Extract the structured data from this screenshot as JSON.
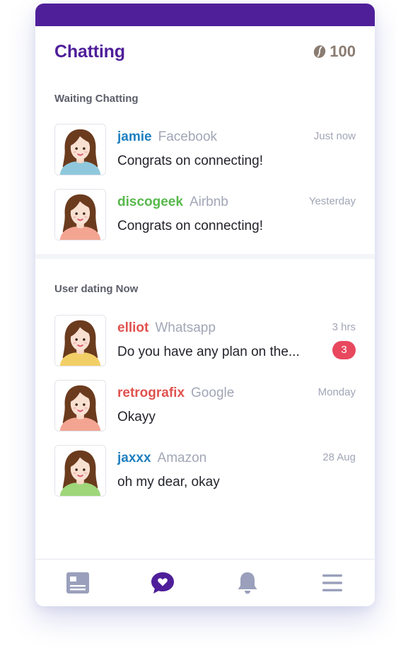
{
  "header": {
    "title": "Chatting",
    "coin_count": "100"
  },
  "colors": {
    "brand": "#4f1f9a",
    "badge": "#e8485e",
    "name_blue": "#2080c0",
    "name_green": "#58b84c",
    "name_red": "#e0524e"
  },
  "sections": [
    {
      "title": "Waiting Chatting",
      "items": [
        {
          "name": "jamie",
          "name_color": "#2080c0",
          "source": "Facebook",
          "message": "Congrats on connecting!",
          "time": "Just now",
          "badge": "",
          "shirt": "#8fc8dc"
        },
        {
          "name": "discogeek",
          "name_color": "#58b84c",
          "source": "Airbnb",
          "message": "Congrats on connecting!",
          "time": "Yesterday",
          "badge": "",
          "shirt": "#f3a592"
        }
      ]
    },
    {
      "title": "User dating Now",
      "items": [
        {
          "name": "elliot",
          "name_color": "#e0524e",
          "source": "Whatsapp",
          "message": "Do you have any plan on the...",
          "time": "3 hrs",
          "badge": "3",
          "shirt": "#f2cf66"
        },
        {
          "name": "retrografix",
          "name_color": "#e0524e",
          "source": "Google",
          "message": "Okayy",
          "time": "Monday",
          "badge": "",
          "shirt": "#f3a592"
        },
        {
          "name": "jaxxx",
          "name_color": "#2080c0",
          "source": "Amazon",
          "message": "oh my dear, okay",
          "time": "28 Aug",
          "badge": "",
          "shirt": "#9fd67a"
        }
      ]
    }
  ],
  "nav": [
    {
      "icon": "news-icon",
      "color": "#9aa0bc"
    },
    {
      "icon": "heart-chat-icon",
      "color": "#4f1f9a"
    },
    {
      "icon": "bell-icon",
      "color": "#9aa0bc"
    },
    {
      "icon": "menu-icon",
      "color": "#9aa0bc"
    }
  ]
}
